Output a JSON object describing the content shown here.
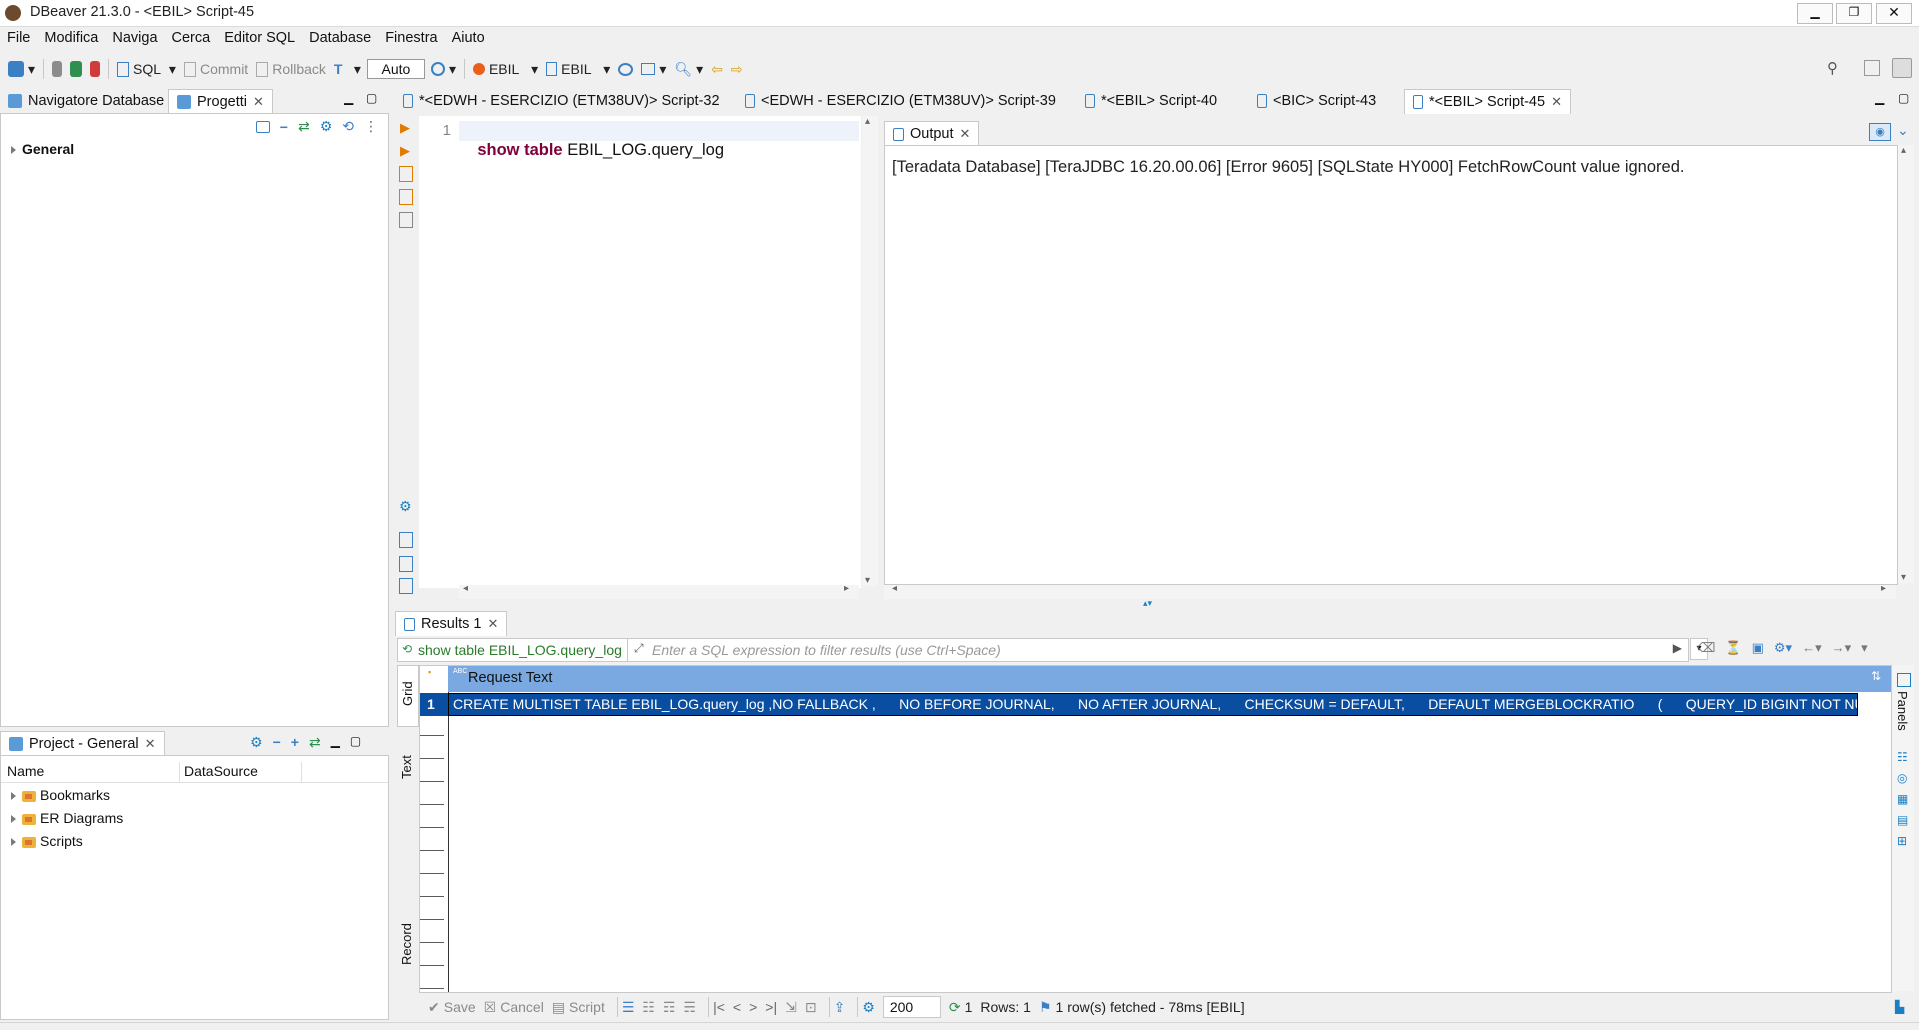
{
  "window": {
    "title": "DBeaver 21.3.0 - <EBIL> Script-45"
  },
  "menu": [
    "File",
    "Modifica",
    "Naviga",
    "Cerca",
    "Editor SQL",
    "Database",
    "Finestra",
    "Aiuto"
  ],
  "toolbar": {
    "sql_label": "SQL",
    "commit_label": "Commit",
    "rollback_label": "Rollback",
    "transaction_mode": "Auto",
    "datasource_label": "EBIL",
    "schema_label": "EBIL"
  },
  "left_top": {
    "tabs": [
      "Navigatore Database",
      "Progetti"
    ],
    "tree": [
      "General"
    ]
  },
  "left_bottom": {
    "title": "Project - General",
    "columns": [
      "Name",
      "DataSource"
    ],
    "items": [
      "Bookmarks",
      "ER Diagrams",
      "Scripts"
    ]
  },
  "editor_tabs": [
    "*<EDWH - ESERCIZIO (ETM38UV)> Script-32",
    "<EDWH - ESERCIZIO (ETM38UV)> Script-39",
    "*<EBIL> Script-40",
    "<BIC> Script-43",
    "*<EBIL> Script-45"
  ],
  "editor": {
    "line_number": "1",
    "keyword": "show table",
    "rest": " EBIL_LOG.query_log"
  },
  "output": {
    "tab_label": "Output",
    "message": "[Teradata Database] [TeraJDBC 16.20.00.06] [Error 9605] [SQLState HY000] FetchRowCount value ignored."
  },
  "results": {
    "tab_label": "Results 1",
    "query_text": "show table EBIL_LOG.query_log",
    "filter_placeholder": "Enter a SQL expression to filter results (use Ctrl+Space)",
    "column_type": "ABC",
    "column_header": "Request Text",
    "row_number": "1",
    "row_value": "CREATE MULTISET TABLE EBIL_LOG.query_log ,NO FALLBACK ,      NO BEFORE JOURNAL,      NO AFTER JOURNAL,      CHECKSUM = DEFAULT,      DEFAULT MERGEBLOCKRATIO      (      QUERY_ID BIGINT NOT NULL,",
    "side_tabs": [
      "Grid",
      "Text",
      "Record"
    ],
    "right_panel_label": "Panels"
  },
  "status": {
    "save": "Save",
    "cancel": "Cancel",
    "script": "Script",
    "fetch_size": "200",
    "refresh_count": "1",
    "rows": "Rows: 1",
    "fetched": "1 row(s) fetched - 78ms [EBIL]"
  },
  "colors": {
    "selection": "#0a4ea2",
    "header_bg": "#79a9e0",
    "keyword": "#7f0037",
    "accent": "#1c7fc4"
  }
}
